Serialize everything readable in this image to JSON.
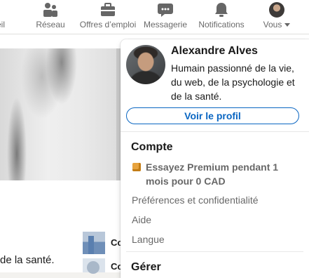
{
  "nav": {
    "home_label": "eil",
    "network_label": "Réseau",
    "jobs_label": "Offres d’emploi",
    "messaging_label": "Messagerie",
    "notifications_label": "Notifications",
    "me_label": "Vous"
  },
  "feed": {
    "post_text": "de la santé.",
    "company_1": "Co",
    "company_2": "Co",
    "right_letters": [
      "Al",
      "s",
      "E",
      "c"
    ]
  },
  "profile_menu": {
    "name": "Alexandre Alves",
    "headline": "Humain passionné de la vie, du web, de la psychologie et de la santé.",
    "view_profile_label": "Voir le profil",
    "account_heading": "Compte",
    "premium_label": "Essayez Premium pendant 1 mois pour 0 CAD",
    "preferences_label": "Préférences et confidentialité",
    "help_label": "Aide",
    "language_label": "Langue",
    "manage_heading": "Gérer"
  },
  "colors": {
    "accent": "#0a66c2",
    "premium": "#e7a33e",
    "background": "#f3f2ef"
  }
}
